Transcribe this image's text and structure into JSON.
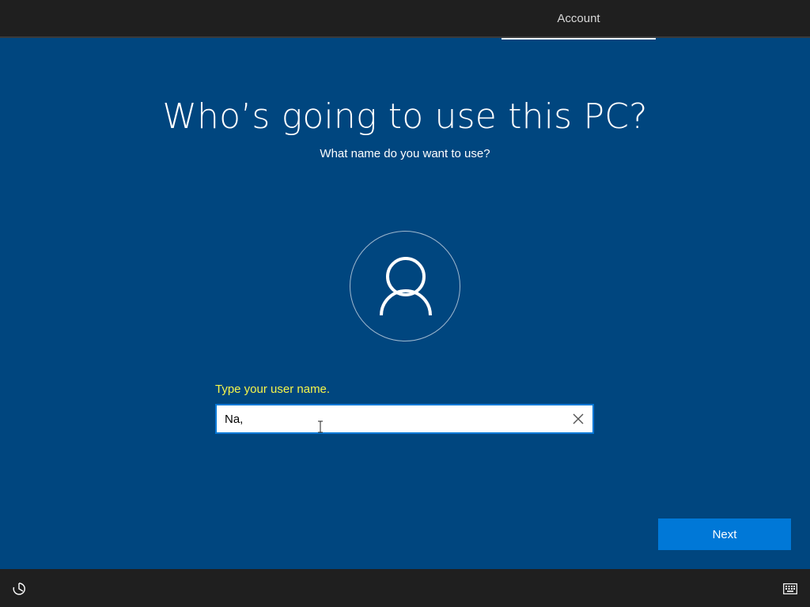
{
  "header": {
    "active_tab": "Account"
  },
  "main": {
    "title": "Who’s going to use this PC?",
    "subtitle": "What name do you want to use?",
    "avatar_icon": "user-icon",
    "field_label": "Type your user name.",
    "username_value": "Na,",
    "clear_icon": "close-icon",
    "next_label": "Next"
  },
  "footer": {
    "left_icon": "ease-of-access-icon",
    "right_icon": "keyboard-icon"
  },
  "colors": {
    "background": "#00467f",
    "bar": "#1f1f1f",
    "accent": "#0078d7",
    "label": "#f5f54a"
  }
}
